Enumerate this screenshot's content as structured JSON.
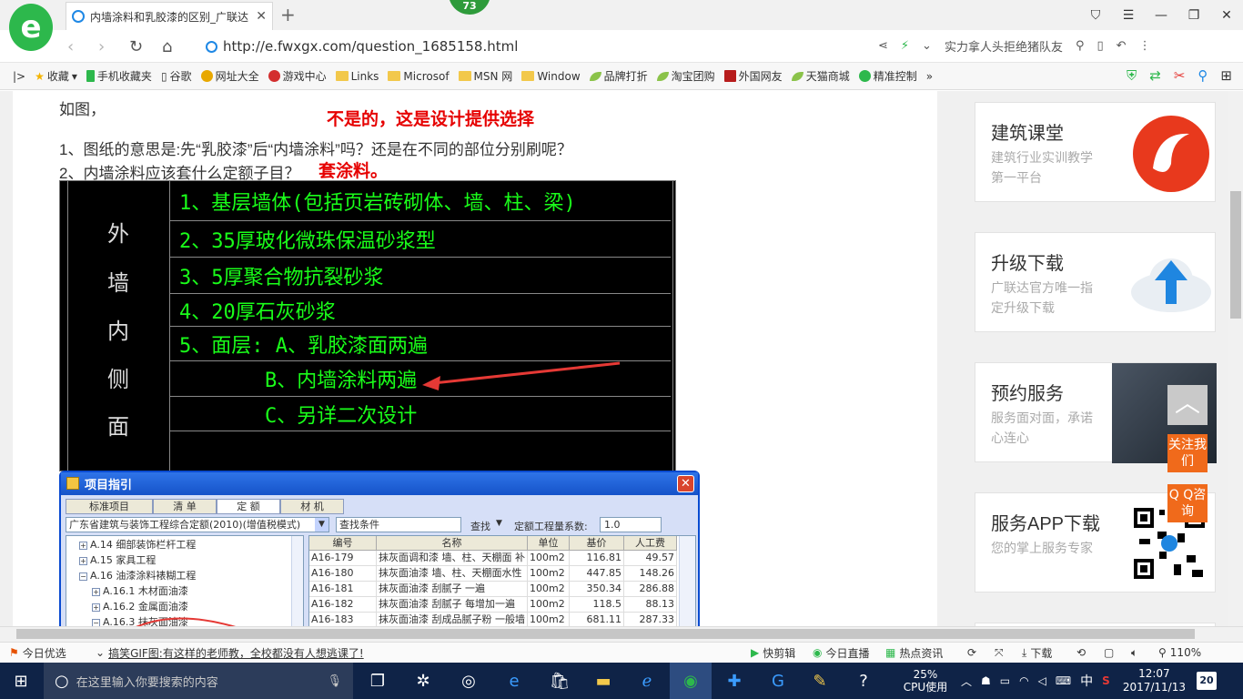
{
  "browser": {
    "tab_title": "内墙涂料和乳胶漆的区别_广联达",
    "new_tab": "+",
    "badge": "73",
    "url": "http://e.fwxgx.com/question_1685158.html",
    "search_text": "实力拿人头拒绝猪队友"
  },
  "bookmarks": [
    "收藏",
    "手机收藏夹",
    "谷歌",
    "网址大全",
    "游戏中心",
    "Links",
    "Microsof",
    "MSN 网",
    "Window",
    "品牌打折",
    "淘宝团购",
    "外国网友",
    "天猫商城",
    "精准控制"
  ],
  "article": {
    "line1": "如图，",
    "answer1": "不是的，这是设计提供选择",
    "line2": "1、图纸的意思是:先“乳胶漆”后“内墙涂料”吗？还是在不同的部位分别刷呢？",
    "line3": "2、内墙涂料应该套什么定额子目？",
    "answer2": "套涂料。"
  },
  "cad": {
    "vertical": [
      "外",
      "墙",
      "内",
      "侧",
      "面"
    ],
    "rows": [
      "1、基层墙体(包括页岩砖砌体、墙、柱、梁)",
      "2、35厚玻化微珠保温砂浆型",
      "3、5厚聚合物抗裂砂浆",
      "4、20厚石灰砂浆",
      "5、面层: A、乳胶漆面两遍",
      "　　B、内墙涂料两遍",
      "　　C、另详二次设计"
    ]
  },
  "dialog": {
    "title": "项目指引",
    "tabs": [
      "标准项目",
      "清 单",
      "定 额",
      "材 机"
    ],
    "standard": "广东省建筑与装饰工程综合定额(2010)(增值税模式)",
    "search_placeholder": "查找条件",
    "find_label": "查找",
    "factor_label": "定额工程量系数:",
    "factor_value": "1.0",
    "tree": [
      {
        "pm": "+",
        "text": "A.14 细部装饰栏杆工程",
        "indent": 0
      },
      {
        "pm": "+",
        "text": "A.15 家具工程",
        "indent": 0
      },
      {
        "pm": "−",
        "text": "A.16 油漆涂料裱糊工程",
        "indent": 0
      },
      {
        "pm": "+",
        "text": "A.16.1  木材面油漆",
        "indent": 1
      },
      {
        "pm": "+",
        "text": "A.16.2  金属面油漆",
        "indent": 1
      },
      {
        "pm": "−",
        "text": "A.16.3  抹灰面油漆",
        "indent": 1
      }
    ],
    "columns": [
      "编号",
      "名称",
      "单位",
      "基价",
      "人工费"
    ],
    "rows": [
      [
        "A16-179",
        "抹灰面调和漆 墙、柱、天棚面 补",
        "100m2",
        "116.81",
        "49.57"
      ],
      [
        "A16-180",
        "抹灰面油漆 墙、柱、天棚面水性",
        "100m2",
        "447.85",
        "148.26"
      ],
      [
        "A16-181",
        "抹灰面油漆 刮腻子 一遍",
        "100m2",
        "350.34",
        "286.88"
      ],
      [
        "A16-182",
        "抹灰面油漆 刮腻子 每增加一遍",
        "100m2",
        "118.5",
        "88.13"
      ],
      [
        "A16-183",
        "抹灰面油漆 刮成品腻子粉 一般墙",
        "100m2",
        "681.11",
        "287.33"
      ]
    ]
  },
  "sidebar": [
    {
      "title": "建筑课堂",
      "sub": "建筑行业实训教学第一平台"
    },
    {
      "title": "升级下载",
      "sub": "广联达官方唯一指定升级下载"
    },
    {
      "title": "预约服务",
      "sub": "服务面对面，承诺心连心"
    },
    {
      "title": "服务APP下载",
      "sub": "您的掌上服务专家"
    }
  ],
  "float": {
    "follow": "关注我们",
    "qq": "Q Q咨询"
  },
  "status": {
    "left": "今日优选",
    "news": "搞笑GIF图:有这样的老师教，全校都没有人想逃课了!",
    "items": [
      "快剪辑",
      "今日直播",
      "热点资讯",
      "下载"
    ],
    "zoom": "110%"
  },
  "taskbar": {
    "search": "在这里输入你要搜索的内容",
    "cpu_percent": "25%",
    "cpu_label": "CPU使用",
    "ime": "中",
    "time": "12:07",
    "date": "2017/11/13",
    "notify": "20"
  }
}
